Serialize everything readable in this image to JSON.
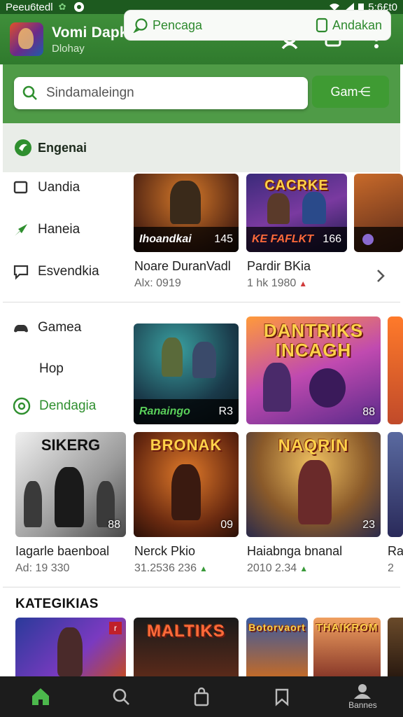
{
  "status_bar": {
    "left_text": "Peeu6tedl",
    "time": "5:6£t0"
  },
  "header": {
    "title": "Vomi Dapkar M",
    "subtitle": "Dlohay"
  },
  "search": {
    "placeholder": "Sindamaleingn",
    "button_label": "Gam⋲"
  },
  "filter": {
    "active_category": "Engenai",
    "chip_left": "Pencaga",
    "chip_right": "Andakan"
  },
  "sidebar": {
    "items": [
      {
        "label": "Uandia",
        "icon": "square-icon"
      },
      {
        "label": "Haneia",
        "icon": "tag-icon"
      },
      {
        "label": "Esvendkia",
        "icon": "chat-icon"
      },
      {
        "label": "Gamea",
        "icon": "gamepad-icon"
      },
      {
        "label": "Hop",
        "icon": ""
      },
      {
        "label": "Dendagia",
        "icon": "compass-icon"
      }
    ]
  },
  "row1": [
    {
      "overlay": "Ihoandkai",
      "count": "145",
      "title": "Noare DuranVadl",
      "sub": "Alx: 0919"
    },
    {
      "art": "CACRKE",
      "overlay": "KE FAFLKT",
      "count": "166",
      "title": "Pardir BKia",
      "sub": "1 hk 1980"
    },
    {
      "art": "",
      "overlay": "",
      "count": ""
    }
  ],
  "row2": [
    {
      "overlay": "Ranaingo",
      "count": "R3"
    },
    {
      "art": "DANTRIKS INCAGH",
      "count": "88"
    }
  ],
  "row3": [
    {
      "art": "SIKERG",
      "count": "88",
      "title": "Iagarle baenboal",
      "sub": "Ad: 19 330"
    },
    {
      "art": "BRONAK",
      "count": "09",
      "title": "Nerck Pkio",
      "sub": "31.2536 236"
    },
    {
      "art": "NAQRIN",
      "count": "23",
      "title": "Haiabnga bnanal",
      "sub": "2010 2.34"
    },
    {
      "title": "Ra",
      "sub": "2"
    }
  ],
  "section": {
    "title": "KATEGIKIAS"
  },
  "row4": [
    {
      "art": ""
    },
    {
      "art": "MALTIKS"
    },
    {
      "art": "Botorvaort"
    },
    {
      "art": "THAIKROM"
    }
  ],
  "bottom_nav": {
    "items": [
      {
        "icon": "home-icon",
        "label": ""
      },
      {
        "icon": "search-icon",
        "label": ""
      },
      {
        "icon": "bag-icon",
        "label": ""
      },
      {
        "icon": "bookmark-icon",
        "label": ""
      },
      {
        "icon": "profile-icon",
        "label": "Bannes"
      }
    ]
  },
  "colors": {
    "primary": "#3f8f3a",
    "accent": "#2f8f2f",
    "nav_bg": "#1c1c1c"
  }
}
